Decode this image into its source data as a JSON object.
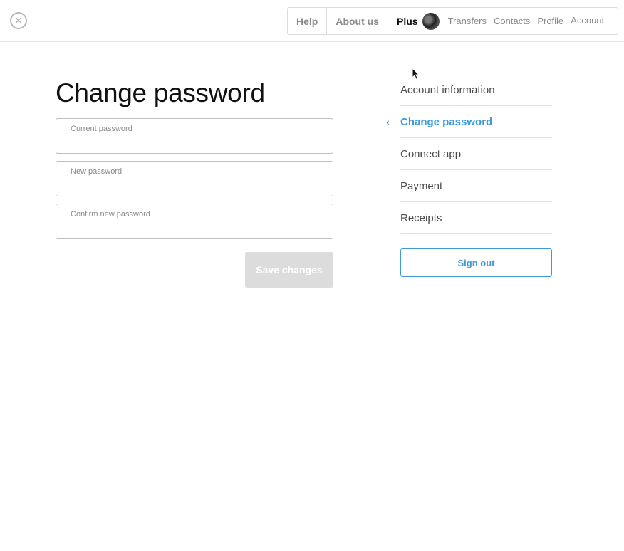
{
  "header": {
    "close_icon": "close-circle-icon",
    "nav": {
      "help": "Help",
      "about": "About us",
      "plus": "Plus",
      "links": [
        "Transfers",
        "Contacts",
        "Profile",
        "Account"
      ]
    }
  },
  "main": {
    "title": "Change password",
    "fields": [
      {
        "label": "Current password",
        "value": ""
      },
      {
        "label": "New password",
        "value": ""
      },
      {
        "label": "Confirm new password",
        "value": ""
      }
    ],
    "save_label": "Save changes"
  },
  "sidebar": {
    "items": [
      {
        "label": "Account information"
      },
      {
        "label": "Change password",
        "active": true
      },
      {
        "label": "Connect app"
      },
      {
        "label": "Payment"
      },
      {
        "label": "Receipts"
      }
    ],
    "signout_label": "Sign out"
  },
  "colors": {
    "accent": "#3d9ad6",
    "disabled_button": "#dcdcdc"
  }
}
